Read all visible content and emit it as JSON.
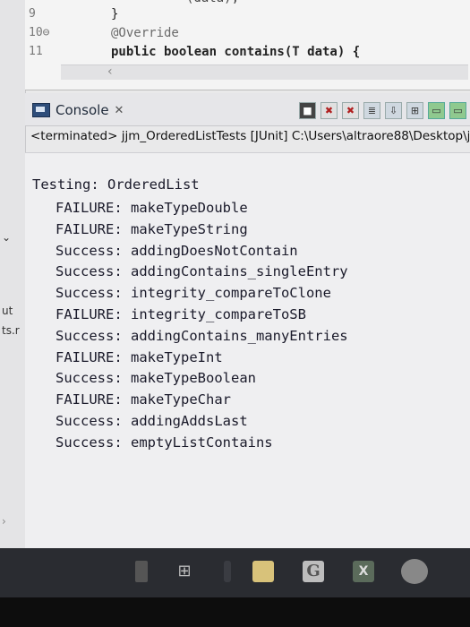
{
  "editor": {
    "lines": [
      {
        "num": "9",
        "code": "}"
      },
      {
        "num": "10⊖",
        "code": "@Override"
      },
      {
        "num": "11",
        "code": "public boolean contains(T data) {"
      }
    ],
    "partial_top": "(data);"
  },
  "left_strip": {
    "labels": [
      "ut",
      "ts.r"
    ]
  },
  "console": {
    "tab_label": "Console",
    "close_glyph": "✕",
    "terminated_text": "<terminated> jjm_OrderedListTests [JUnit] C:\\Users\\altraore88\\Desktop\\j",
    "header": "Testing: OrderedList",
    "results": [
      {
        "status": "FAILURE:",
        "test": "makeTypeDouble"
      },
      {
        "status": "FAILURE:",
        "test": "makeTypeString"
      },
      {
        "status": "Success:",
        "test": "addingDoesNotContain"
      },
      {
        "status": "Success:",
        "test": "addingContains_singleEntry"
      },
      {
        "status": "Success:",
        "test": "integrity_compareToClone"
      },
      {
        "status": "FAILURE:",
        "test": "integrity_compareToSB"
      },
      {
        "status": "Success:",
        "test": "addingContains_manyEntries"
      },
      {
        "status": "FAILURE:",
        "test": "makeTypeInt"
      },
      {
        "status": "Success:",
        "test": "makeTypeBoolean"
      },
      {
        "status": "FAILURE:",
        "test": "makeTypeChar"
      },
      {
        "status": "Success:",
        "test": "addingAddsLast"
      },
      {
        "status": "Success:",
        "test": "emptyListContains"
      }
    ]
  },
  "taskbar": {
    "apps": [
      "phone-icon",
      "calculator-icon",
      "folder-icon",
      "chrome-icon",
      "excel-icon",
      "eclipse-icon"
    ],
    "chrome_letter": "G",
    "excel_letter": "X"
  },
  "colors": {
    "console_bg": "#efeff1",
    "taskbar_bg": "#2a2c31"
  }
}
